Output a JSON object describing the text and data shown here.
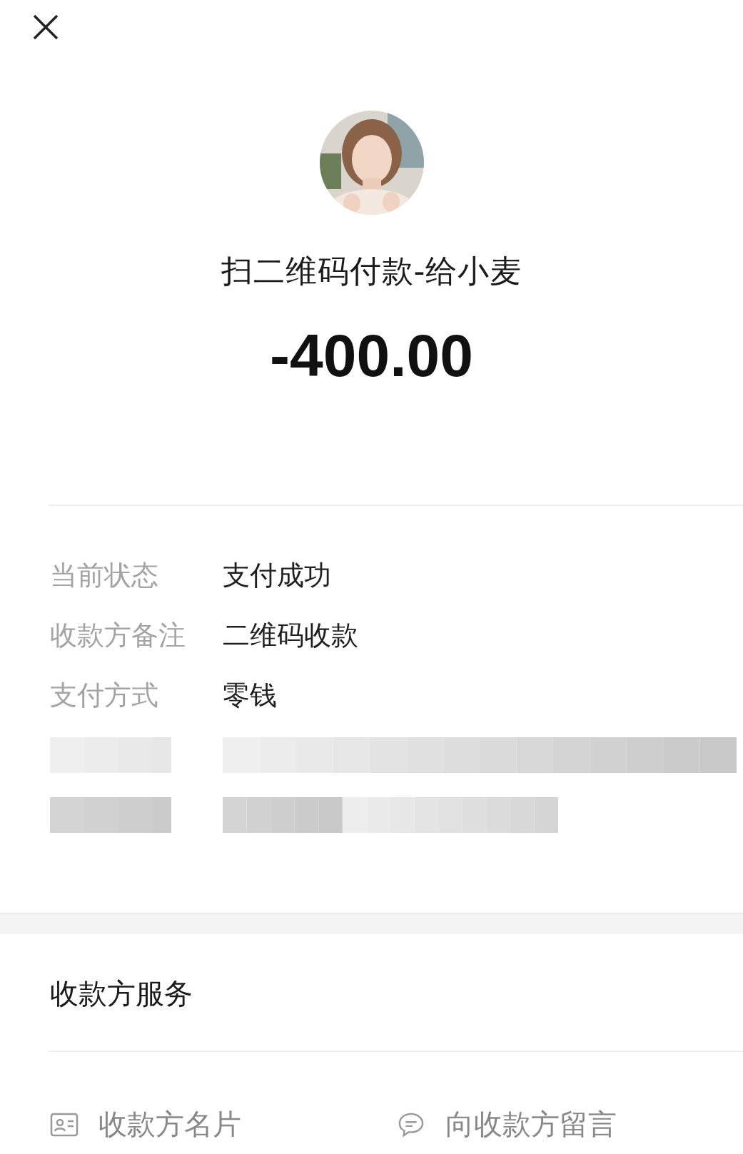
{
  "title": "扫二维码付款-给小麦",
  "amount": "-400.00",
  "details": [
    {
      "kind": "text",
      "label": "当前状态",
      "value": "支付成功"
    },
    {
      "kind": "text",
      "label": "收款方备注",
      "value": "二维码收款"
    },
    {
      "kind": "text",
      "label": "支付方式",
      "value": "零钱"
    },
    {
      "kind": "redacted"
    },
    {
      "kind": "redacted"
    }
  ],
  "service": {
    "title": "收款方服务",
    "actions": [
      {
        "kind": "card",
        "label": "收款方名片"
      },
      {
        "kind": "message",
        "label": "向收款方留言"
      }
    ]
  }
}
